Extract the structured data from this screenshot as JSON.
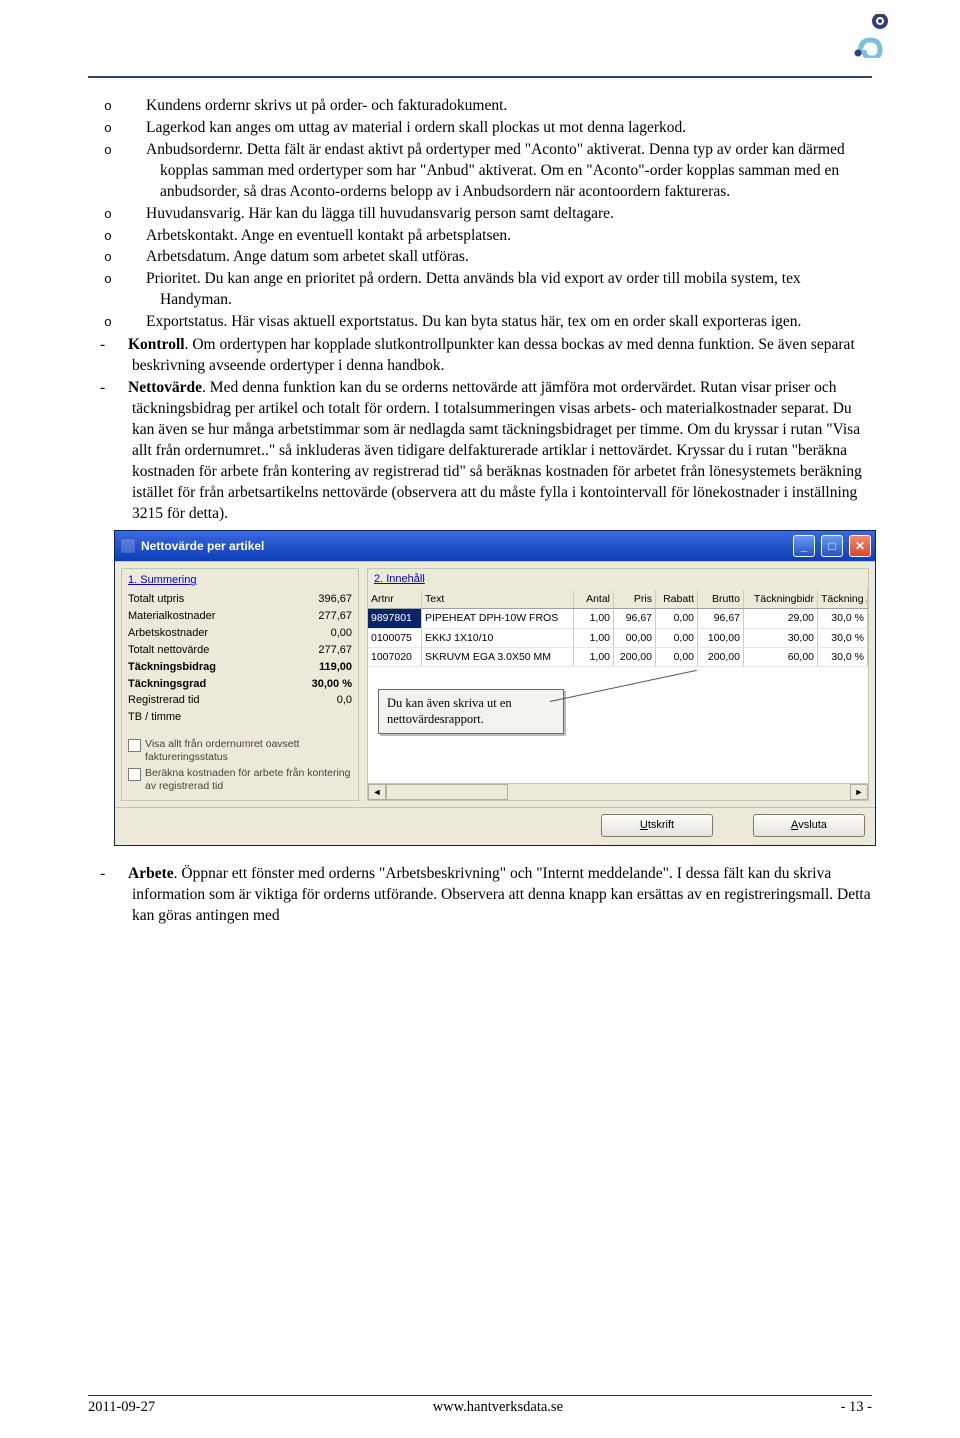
{
  "bullets": {
    "b1": "Kundens ordernr skrivs ut på order- och fakturadokument.",
    "b2": "Lagerkod kan anges om uttag av material i ordern skall plockas ut mot denna lagerkod.",
    "b3": "Anbudsordernr. Detta fält är endast aktivt på ordertyper med \"Aconto\" aktiverat. Denna typ av order kan därmed kopplas samman med ordertyper som har \"Anbud\" aktiverat. Om en \"Aconto\"-order kopplas samman med en anbudsorder, så dras Aconto-orderns belopp av i Anbudsordern när acontoordern faktureras.",
    "b4": "Huvudansvarig. Här kan du lägga till huvudansvarig person samt deltagare.",
    "b5": "Arbetskontakt. Ange en eventuell kontakt på arbetsplatsen.",
    "b6": "Arbetsdatum. Ange datum som arbetet skall utföras.",
    "b7": "Prioritet. Du kan ange en prioritet på ordern. Detta används bla vid export av order till mobila system, tex Handyman.",
    "b8": "Exportstatus. Här visas aktuell exportstatus. Du kan byta status här, tex om en order skall exporteras igen."
  },
  "main": {
    "kontroll_label": "Kontroll",
    "kontroll_text": ". Om ordertypen har kopplade slutkontrollpunkter kan dessa bockas av med denna funktion. Se även separat beskrivning avseende ordertyper i denna handbok.",
    "netto_label": "Nettovärde",
    "netto_text": ". Med denna funktion kan du se orderns nettovärde att jämföra mot ordervärdet. Rutan visar priser och täckningsbidrag per artikel och totalt för ordern. I totalsummeringen visas arbets- och materialkostnader separat. Du kan även se hur många arbetstimmar som är nedlagda samt täckningsbidraget per timme. Om du kryssar i rutan \"Visa allt från ordernumret..\" så inkluderas även tidigare delfakturerade artiklar i nettovärdet. Kryssar du i rutan \"beräkna kostnaden för arbete från kontering av registrerad tid\" så beräknas kostnaden för arbetet från lönesystemets beräkning istället för från arbetsartikelns nettovärde (observera att du måste fylla i kontointervall för lönekostnader i inställning 3215 för detta).",
    "arbete_label": "Arbete",
    "arbete_text": ". Öppnar ett fönster med orderns \"Arbetsbeskrivning\" och \"Internt meddelande\". I dessa fält kan du skriva information som är viktiga för orderns utförande. Observera att denna knapp kan ersättas av en registreringsmall. Detta kan göras antingen med"
  },
  "window": {
    "title": "Nettovärde per artikel",
    "left_title": "1. Summering",
    "right_title": "2. Innehåll",
    "summary": [
      {
        "label": "Totalt utpris",
        "value": "396,67",
        "bold": false
      },
      {
        "label": "Materialkostnader",
        "value": "277,67",
        "bold": false
      },
      {
        "label": "Arbetskostnader",
        "value": "0,00",
        "bold": false
      },
      {
        "label": "Totalt nettovärde",
        "value": "277,67",
        "bold": false
      },
      {
        "label": "Täckningsbidrag",
        "value": "119,00",
        "bold": true
      },
      {
        "label": "Täckningsgrad",
        "value": "30,00 %",
        "bold": true
      },
      {
        "label": "Registrerad tid",
        "value": "0,0",
        "bold": false
      },
      {
        "label": "TB / timme",
        "value": "",
        "bold": false
      }
    ],
    "check1": "Visa allt från ordernumret oavsett faktureringsstatus",
    "check2": "Beräkna kostnaden för arbete från kontering av registrerad tid",
    "headers": {
      "art": "Artnr",
      "txt": "Text",
      "ant": "Antal",
      "pris": "Pris",
      "rab": "Rabatt",
      "bru": "Brutto",
      "tb": "Täckningbidr",
      "tp": "Täckning"
    },
    "rows": [
      {
        "art": "9897801",
        "txt": "PIPEHEAT DPH-10W FROS",
        "ant": "1,00",
        "pris": "96,67",
        "rab": "0,00",
        "bru": "96,67",
        "tb": "29,00",
        "tp": "30,0 %",
        "sel": true
      },
      {
        "art": "0100075",
        "txt": "EKKJ 1X10/10",
        "ant": "1,00",
        "pris": "00,00",
        "rab": "0,00",
        "bru": "100,00",
        "tb": "30,00",
        "tp": "30,0 %",
        "sel": false
      },
      {
        "art": "1007020",
        "txt": "SKRUVM EGA 3.0X50 MM",
        "ant": "1,00",
        "pris": "200,00",
        "rab": "0,00",
        "bru": "200,00",
        "tb": "60,00",
        "tp": "30,0 %",
        "sel": false
      }
    ],
    "callout": "Du kan även skriva ut en nettovärdesrapport.",
    "btn_print": "Utskrift",
    "btn_close": "Avsluta"
  },
  "footer": {
    "date": "2011-09-27",
    "url": "www.hantverksdata.se",
    "page": "- 13 -"
  }
}
